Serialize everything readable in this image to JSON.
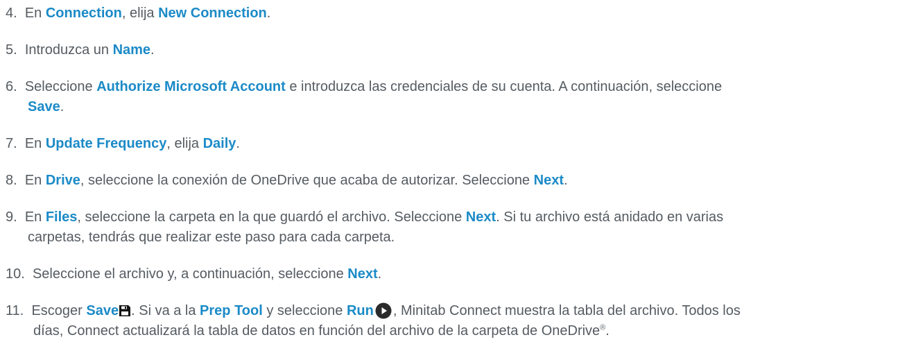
{
  "steps": [
    {
      "num": "4.",
      "t1": "En ",
      "l1": "Connection",
      "t2": ", elija ",
      "l2": "New Connection",
      "t3": "."
    },
    {
      "num": "5.",
      "t1": "Introduzca un ",
      "l1": "Name",
      "t2": "."
    },
    {
      "num": "6.",
      "t1": "Seleccione ",
      "l1": "Authorize Microsoft Account",
      "t2": " e introduzca las credenciales de su cuenta. A continuación, seleccione",
      "l2": "Save",
      "t3": "."
    },
    {
      "num": "7.",
      "t1": "En ",
      "l1": "Update Frequency",
      "t2": ", elija ",
      "l2": "Daily",
      "t3": "."
    },
    {
      "num": "8.",
      "t1": "En ",
      "l1": "Drive",
      "t2": ", seleccione la conexión de OneDrive que acaba de autorizar. Seleccione ",
      "l2": "Next",
      "t3": "."
    },
    {
      "num": "9.",
      "t1": "En ",
      "l1": "Files",
      "t2": ", seleccione la carpeta en la que guardó el archivo. Seleccione ",
      "l2": "Next",
      "t3": ". Si tu archivo está anidado en varias",
      "t4": "carpetas, tendrás que realizar este paso para cada carpeta."
    },
    {
      "num": "10.",
      "t1": "Seleccione el archivo y, a continuación, seleccione ",
      "l1": "Next",
      "t2": "."
    },
    {
      "num": "11.",
      "t1": "Escoger ",
      "l1": "Save",
      "t2": ". Si va a la ",
      "l2": "Prep Tool",
      "t3": " y seleccione ",
      "l3": "Run",
      "t4": ", Minitab Connect muestra la tabla del archivo. Todos los",
      "t5": "días, Connect actualizará la tabla de datos en función del archivo de la carpeta de OneDrive",
      "sup": "®",
      "t6": "."
    }
  ],
  "icons": {
    "save": "save-icon",
    "run": "play-circle-icon"
  },
  "colors": {
    "link": "#1b8ac7",
    "text": "#555b61"
  }
}
